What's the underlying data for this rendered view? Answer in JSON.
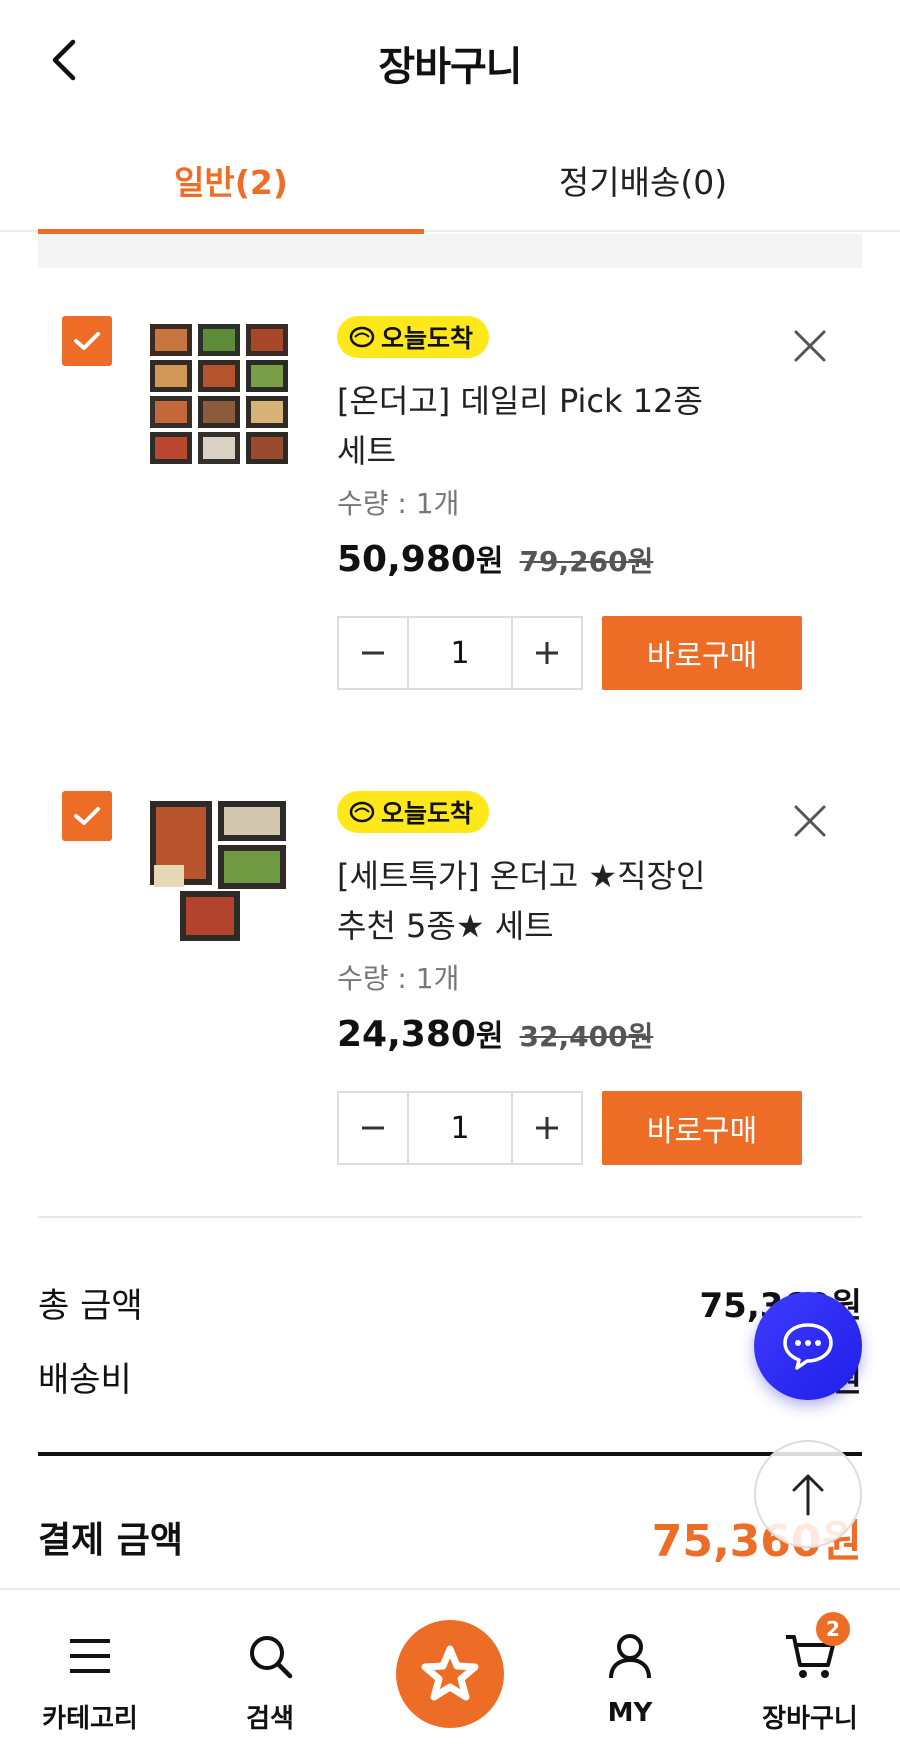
{
  "header": {
    "title": "장바구니"
  },
  "tabs": [
    {
      "label": "일반(2)"
    },
    {
      "label": "정기배송(0)"
    }
  ],
  "items": [
    {
      "badge": "오늘도착",
      "name": "[온더고] 데일리 Pick 12종 세트",
      "qty_label": "수량 : 1개",
      "price": "50,980",
      "price_unit": "원",
      "original_price": "79,260원",
      "quantity": "1",
      "buy_label": "바로구매"
    },
    {
      "badge": "오늘도착",
      "name": "[세트특가] 온더고 ★직장인 추천 5종★ 세트",
      "qty_label": "수량 : 1개",
      "price": "24,380",
      "price_unit": "원",
      "original_price": "32,400원",
      "quantity": "1",
      "buy_label": "바로구매"
    }
  ],
  "summary": {
    "total_label": "총 금액",
    "total_value": "75,360원",
    "shipping_label": "배송비",
    "shipping_value": "0원",
    "pay_label": "결제 금액",
    "pay_value": "75,360원"
  },
  "nav": {
    "category": "카테고리",
    "search": "검색",
    "my": "MY",
    "cart": "장바구니",
    "cart_count": "2"
  },
  "colors": {
    "accent": "#ee6d26",
    "badge": "#ffe81a",
    "chat": "#2b2af0"
  }
}
